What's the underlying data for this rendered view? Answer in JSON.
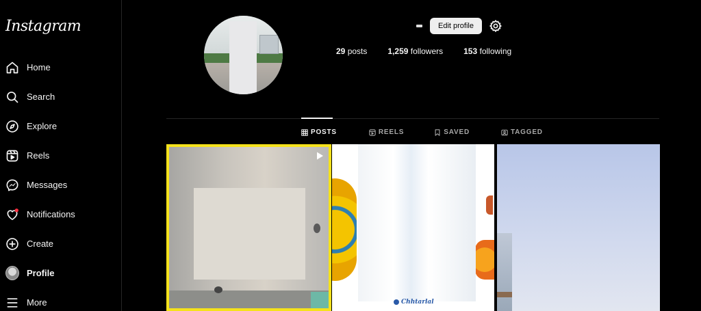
{
  "app": {
    "logo": "Instagram"
  },
  "sidebar": {
    "items": [
      {
        "label": "Home",
        "icon": "home-icon"
      },
      {
        "label": "Search",
        "icon": "search-icon"
      },
      {
        "label": "Explore",
        "icon": "compass-icon"
      },
      {
        "label": "Reels",
        "icon": "reels-icon"
      },
      {
        "label": "Messages",
        "icon": "messenger-icon"
      },
      {
        "label": "Notifications",
        "icon": "heart-icon"
      },
      {
        "label": "Create",
        "icon": "plus-square-icon"
      },
      {
        "label": "Profile",
        "icon": "avatar"
      },
      {
        "label": "More",
        "icon": "hamburger-icon"
      }
    ],
    "active": "Profile",
    "notification_dot_color": "#ff3040"
  },
  "profile": {
    "edit_label": "Edit profile",
    "stats": {
      "posts_count": "29",
      "posts_label": "posts",
      "followers_count": "1,259",
      "followers_label": "followers",
      "following_count": "153",
      "following_label": "following"
    }
  },
  "tabs": [
    {
      "label": "POSTS",
      "icon": "grid-icon",
      "active": true
    },
    {
      "label": "REELS",
      "icon": "reels-icon",
      "active": false
    },
    {
      "label": "SAVED",
      "icon": "bookmark-icon",
      "active": false
    },
    {
      "label": "TAGGED",
      "icon": "tag-icon",
      "active": false
    }
  ],
  "grid": {
    "posts": [
      {
        "type": "reel",
        "highlighted": true,
        "highlight_color": "#f5e21b"
      },
      {
        "type": "image",
        "brand_text": "Chhtarlal"
      },
      {
        "type": "image"
      }
    ]
  }
}
